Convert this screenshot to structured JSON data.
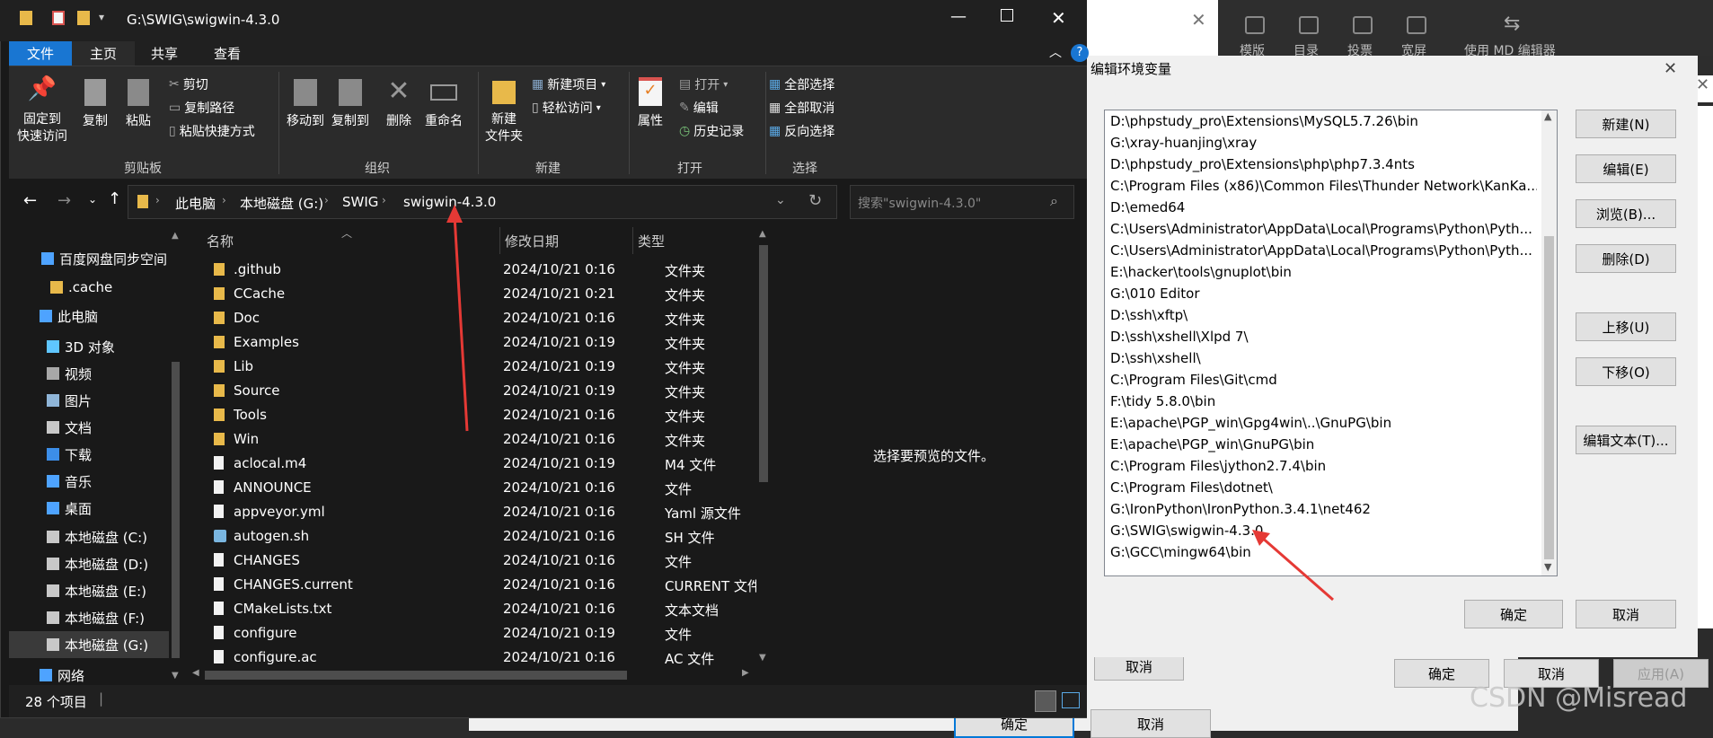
{
  "explorer": {
    "title": "G:\\SWIG\\swigwin-4.3.0",
    "ribbon_tabs": [
      "文件",
      "主页",
      "共享",
      "查看"
    ],
    "clipboard": {
      "pin": "固定到\n快速访问",
      "copy": "复制",
      "paste": "粘贴",
      "cut": "剪切",
      "copy_path": "复制路径",
      "paste_shortcut": "粘贴快捷方式",
      "group": "剪贴板"
    },
    "organize": {
      "move_to": "移动到",
      "copy_to": "复制到",
      "delete": "删除",
      "rename": "重命名",
      "group": "组织"
    },
    "new": {
      "new_folder": "新建\n文件夹",
      "new_item": "新建项目",
      "easy_access": "轻松访问",
      "group": "新建"
    },
    "open": {
      "properties": "属性",
      "open": "打开",
      "edit": "编辑",
      "history": "历史记录",
      "group": "打开"
    },
    "select": {
      "select_all": "全部选择",
      "select_none": "全部取消",
      "invert": "反向选择",
      "group": "选择"
    },
    "breadcrumb": [
      "此电脑",
      "本地磁盘 (G:)",
      "SWIG",
      "swigwin-4.3.0"
    ],
    "search_placeholder": "搜索\"swigwin-4.3.0\"",
    "nav_items": [
      {
        "label": "百度网盘同步空间",
        "icon": "cloud-icon"
      },
      {
        "label": ".cache",
        "icon": "folder-icon"
      },
      {
        "label": "此电脑",
        "icon": "computer-icon"
      },
      {
        "label": "3D 对象",
        "icon": "cube-icon"
      },
      {
        "label": "视频",
        "icon": "video-icon"
      },
      {
        "label": "图片",
        "icon": "picture-icon"
      },
      {
        "label": "文档",
        "icon": "document-icon"
      },
      {
        "label": "下载",
        "icon": "download-icon"
      },
      {
        "label": "音乐",
        "icon": "music-icon"
      },
      {
        "label": "桌面",
        "icon": "desktop-icon"
      },
      {
        "label": "本地磁盘 (C:)",
        "icon": "drive-icon"
      },
      {
        "label": "本地磁盘 (D:)",
        "icon": "drive-icon"
      },
      {
        "label": "本地磁盘 (E:)",
        "icon": "drive-icon"
      },
      {
        "label": "本地磁盘 (F:)",
        "icon": "drive-icon"
      },
      {
        "label": "本地磁盘 (G:)",
        "icon": "drive-icon"
      },
      {
        "label": "网络",
        "icon": "network-icon"
      }
    ],
    "columns": [
      "名称",
      "修改日期",
      "类型"
    ],
    "files": [
      {
        "name": ".github",
        "date": "2024/10/21 0:16",
        "type": "文件夹",
        "kind": "folder"
      },
      {
        "name": "CCache",
        "date": "2024/10/21 0:21",
        "type": "文件夹",
        "kind": "folder"
      },
      {
        "name": "Doc",
        "date": "2024/10/21 0:16",
        "type": "文件夹",
        "kind": "folder"
      },
      {
        "name": "Examples",
        "date": "2024/10/21 0:19",
        "type": "文件夹",
        "kind": "folder"
      },
      {
        "name": "Lib",
        "date": "2024/10/21 0:19",
        "type": "文件夹",
        "kind": "folder"
      },
      {
        "name": "Source",
        "date": "2024/10/21 0:19",
        "type": "文件夹",
        "kind": "folder"
      },
      {
        "name": "Tools",
        "date": "2024/10/21 0:16",
        "type": "文件夹",
        "kind": "folder"
      },
      {
        "name": "Win",
        "date": "2024/10/21 0:16",
        "type": "文件夹",
        "kind": "folder"
      },
      {
        "name": "aclocal.m4",
        "date": "2024/10/21 0:19",
        "type": "M4 文件",
        "kind": "file"
      },
      {
        "name": "ANNOUNCE",
        "date": "2024/10/21 0:16",
        "type": "文件",
        "kind": "file"
      },
      {
        "name": "appveyor.yml",
        "date": "2024/10/21 0:16",
        "type": "Yaml 源文件",
        "kind": "file"
      },
      {
        "name": "autogen.sh",
        "date": "2024/10/21 0:16",
        "type": "SH 文件",
        "kind": "script"
      },
      {
        "name": "CHANGES",
        "date": "2024/10/21 0:16",
        "type": "文件",
        "kind": "file"
      },
      {
        "name": "CHANGES.current",
        "date": "2024/10/21 0:16",
        "type": "CURRENT 文件",
        "kind": "file"
      },
      {
        "name": "CMakeLists.txt",
        "date": "2024/10/21 0:16",
        "type": "文本文档",
        "kind": "file"
      },
      {
        "name": "configure",
        "date": "2024/10/21 0:19",
        "type": "文件",
        "kind": "file"
      },
      {
        "name": "configure.ac",
        "date": "2024/10/21 0:16",
        "type": "AC 文件",
        "kind": "file"
      }
    ],
    "preview_text": "选择要预览的文件。",
    "status": "28 个项目"
  },
  "env_dialog": {
    "title": "编辑环境变量",
    "paths": [
      "D:\\phpstudy_pro\\Extensions\\MySQL5.7.26\\bin",
      "G:\\xray-huanjing\\xray",
      "D:\\phpstudy_pro\\Extensions\\php\\php7.3.4nts",
      "C:\\Program Files (x86)\\Common Files\\Thunder Network\\KanKa...",
      "D:\\emed64",
      "C:\\Users\\Administrator\\AppData\\Local\\Programs\\Python\\Pyth...",
      "C:\\Users\\Administrator\\AppData\\Local\\Programs\\Python\\Pyth...",
      "E:\\hacker\\tools\\gnuplot\\bin",
      "G:\\010 Editor",
      "D:\\ssh\\xftp\\",
      "D:\\ssh\\xshell\\Xlpd 7\\",
      "D:\\ssh\\xshell\\",
      "C:\\Program Files\\Git\\cmd",
      "F:\\tidy 5.8.0\\bin",
      "E:\\apache\\PGP_win\\Gpg4win\\..\\GnuPG\\bin",
      "E:\\apache\\PGP_win\\GnuPG\\bin",
      "C:\\Program Files\\jython2.7.4\\bin",
      "C:\\Program Files\\dotnet\\",
      "G:\\IronPython\\IronPython.3.4.1\\net462",
      "G:\\SWIG\\swigwin-4.3.0",
      "G:\\GCC\\mingw64\\bin"
    ],
    "buttons": {
      "new": "新建(N)",
      "edit": "编辑(E)",
      "browse": "浏览(B)...",
      "delete": "删除(D)",
      "up": "上移(U)",
      "down": "下移(O)",
      "edit_text": "编辑文本(T)...",
      "ok": "确定",
      "cancel": "取消"
    }
  },
  "background": {
    "toolbar_labels": [
      "模版",
      "目录",
      "投票",
      "宽屏",
      "使用 MD 编辑器"
    ],
    "cancel1": "取消",
    "ok2": "确定",
    "cancel2": "取消",
    "apply": "应用(A)",
    "ok3": "确定",
    "cancel3": "取消",
    "watermark": "CSDN @Misread"
  },
  "colors": {
    "arrow": "#e53935",
    "folder": "#e8b94a",
    "accent": "#0078d7"
  }
}
